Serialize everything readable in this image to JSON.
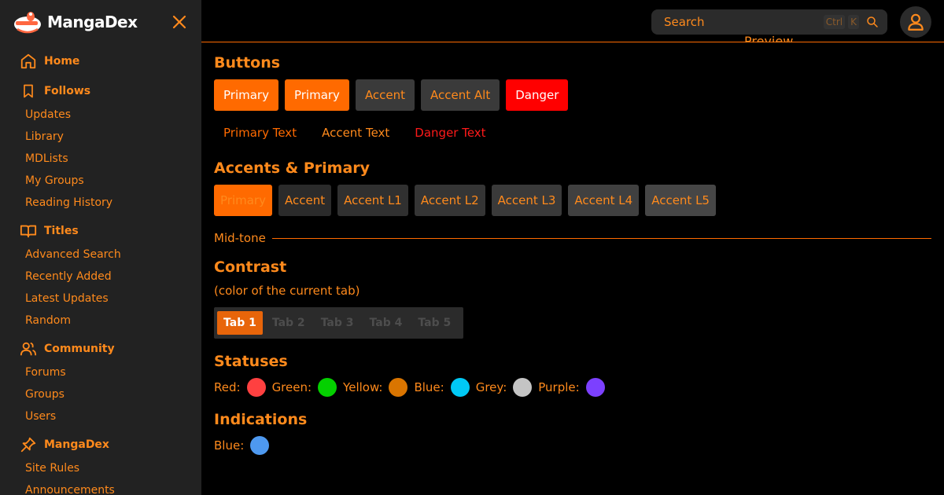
{
  "brand": {
    "name": "MangaDex"
  },
  "sidebar": {
    "sections": [
      {
        "label": "Home",
        "icon": "home-icon",
        "items": []
      },
      {
        "label": "Follows",
        "icon": "bookmark-icon",
        "items": [
          "Updates",
          "Library",
          "MDLists",
          "My Groups",
          "Reading History"
        ]
      },
      {
        "label": "Titles",
        "icon": "book-icon",
        "items": [
          "Advanced Search",
          "Recently Added",
          "Latest Updates",
          "Random"
        ]
      },
      {
        "label": "Community",
        "icon": "users-icon",
        "items": [
          "Forums",
          "Groups",
          "Users"
        ]
      },
      {
        "label": "MangaDex",
        "icon": "pin-icon",
        "items": [
          "Site Rules",
          "Announcements"
        ]
      }
    ]
  },
  "header": {
    "search_placeholder": "Search",
    "shortcut_keys": [
      "Ctrl",
      "K"
    ]
  },
  "preview_heading": "Preview",
  "buttons": {
    "title": "Buttons",
    "filled": [
      {
        "label": "Primary",
        "variant": "primary"
      },
      {
        "label": "Primary",
        "variant": "primary"
      },
      {
        "label": "Accent",
        "variant": "accent"
      },
      {
        "label": "Accent Alt",
        "variant": "accent"
      },
      {
        "label": "Danger",
        "variant": "danger"
      }
    ],
    "text": [
      {
        "label": "Primary Text",
        "variant": "primary"
      },
      {
        "label": "Accent Text",
        "variant": "accent"
      },
      {
        "label": "Danger Text",
        "variant": "danger"
      }
    ]
  },
  "accents": {
    "title": "Accents & Primary",
    "swatches": [
      {
        "label": "Primary",
        "bg": "#ff6a00",
        "fg": "#ff8a1c"
      },
      {
        "label": "Accent",
        "bg": "#2b2b2b",
        "fg": "#ff8a1c"
      },
      {
        "label": "Accent L1",
        "bg": "#303030",
        "fg": "#ff8a1c"
      },
      {
        "label": "Accent L2",
        "bg": "#353535",
        "fg": "#ff8a1c"
      },
      {
        "label": "Accent L3",
        "bg": "#3a3a3a",
        "fg": "#ff8a1c"
      },
      {
        "label": "Accent L4",
        "bg": "#404040",
        "fg": "#ff8a1c"
      },
      {
        "label": "Accent L5",
        "bg": "#464646",
        "fg": "#ff8a1c"
      }
    ]
  },
  "midtone": {
    "label": "Mid-tone"
  },
  "contrast": {
    "title": "Contrast",
    "subtitle": "(color of the current tab)",
    "tabs": [
      "Tab 1",
      "Tab 2",
      "Tab 3",
      "Tab 4",
      "Tab 5"
    ],
    "active_index": 0
  },
  "statuses": {
    "title": "Statuses",
    "items": [
      {
        "label": "Red:",
        "color": "#ff4040"
      },
      {
        "label": "Green:",
        "color": "#04d000"
      },
      {
        "label": "Yellow:",
        "color": "#da7500"
      },
      {
        "label": "Blue:",
        "color": "#00c9f5"
      },
      {
        "label": "Grey:",
        "color": "#c4c4c4"
      },
      {
        "label": "Purple:",
        "color": "#7c40ff"
      }
    ]
  },
  "indications": {
    "title": "Indications",
    "items": [
      {
        "label": "Blue:",
        "color": "#4e99f0"
      }
    ]
  },
  "colors": {
    "accent": "#ff8a1c",
    "primary": "#ff6a00",
    "sidebar_bg": "#222222"
  }
}
